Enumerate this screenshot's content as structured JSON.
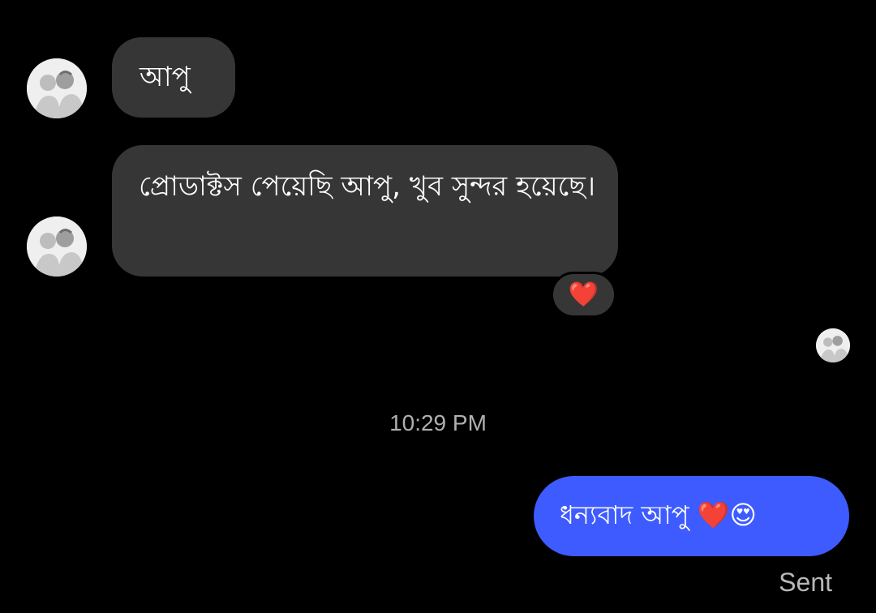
{
  "messages": [
    {
      "direction": "incoming",
      "text": "আপু"
    },
    {
      "direction": "incoming",
      "text": "প্রোডাক্টস পেয়েছি আপু, খুব সুন্দর হয়েছে।",
      "reaction": "❤️"
    },
    {
      "direction": "outgoing",
      "text": "ধন্যবাদ আপু ❤️😍",
      "status": "Sent"
    }
  ],
  "divider": {
    "time": "10:29 PM"
  },
  "colors": {
    "background": "#000000",
    "incoming_bubble": "#363636",
    "outgoing_bubble": "#3e5bff",
    "timestamp": "#b0b0b0"
  },
  "icons": {
    "sender_avatar": "contact-photo-avatar",
    "seen_avatar": "read-receipt-avatar"
  }
}
